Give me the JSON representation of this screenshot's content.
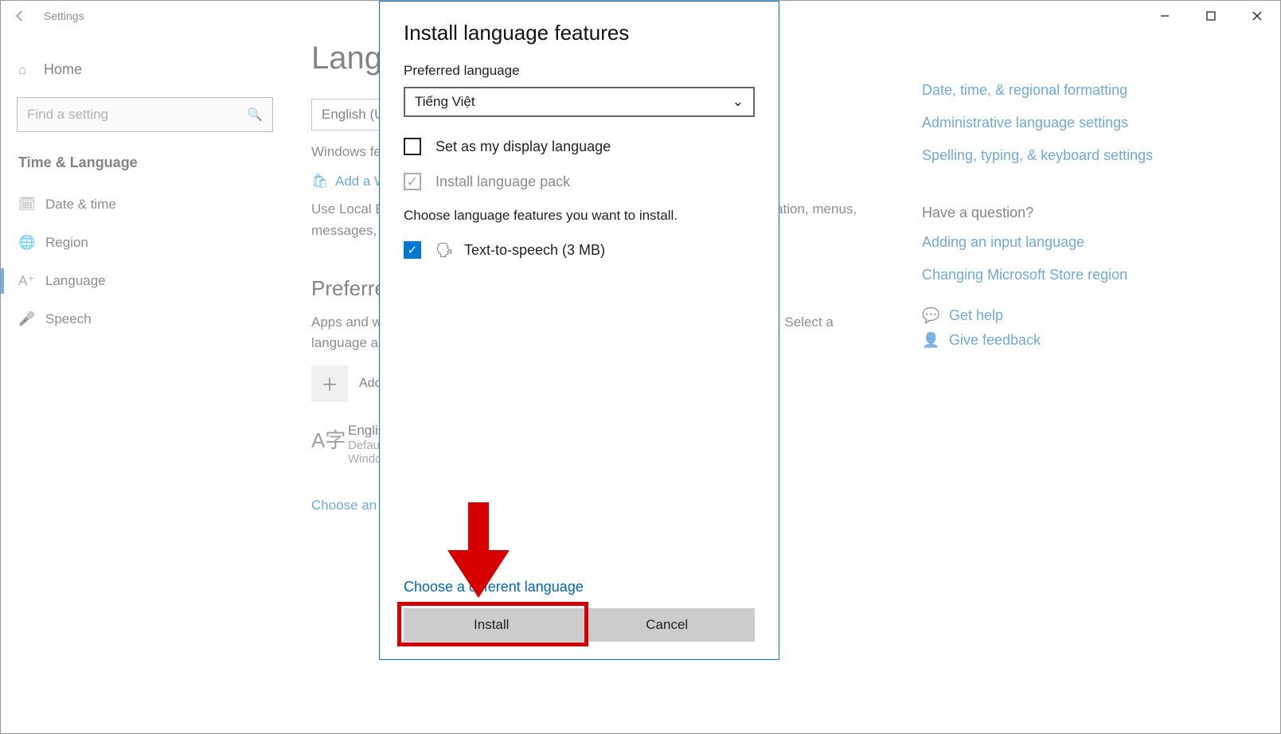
{
  "titlebar": {
    "title": "Settings"
  },
  "sidebar": {
    "home": "Home",
    "search_placeholder": "Find a setting",
    "section": "Time & Language",
    "items": [
      {
        "label": "Date & time"
      },
      {
        "label": "Region"
      },
      {
        "label": "Language"
      },
      {
        "label": "Speech"
      }
    ]
  },
  "main": {
    "heading": "Language",
    "display_lang_value": "English (United States)",
    "display_lang_desc": "Windows features like Settings and File Explorer will appear in this language.",
    "add_display_link": "Add a Windows display language in Microsoft Store",
    "local_exp_desc": "Use Local Experience Packs to change the language Windows uses for navigation, menus, messages, settings, and help topics.",
    "pref_heading": "Preferred languages",
    "pref_desc": "Apps and websites will appear in the first language in the list that they support. Select a language and then select Options to configure keyboards and other features.",
    "add_lang": "Add a language",
    "lang_name": "English (United States)",
    "lang_sub1": "Default app language; Default input language;",
    "lang_sub2": "Windows display language",
    "choose_input": "Choose an input method to always use as default"
  },
  "rightcol": {
    "link1": "Date, time, & regional formatting",
    "link2": "Administrative language settings",
    "link3": "Spelling, typing, & keyboard settings",
    "question": "Have a question?",
    "help1": "Adding an input language",
    "help2": "Changing Microsoft Store region",
    "gethelp": "Get help",
    "feedback": "Give feedback"
  },
  "modal": {
    "title": "Install language features",
    "pref_label": "Preferred language",
    "selected": "Tiếng Việt",
    "set_display": "Set as my display language",
    "install_pack": "Install language pack",
    "choose_feat": "Choose language features you want to install.",
    "tts": "Text-to-speech (3 MB)",
    "choose_diff": "Choose a different language",
    "install_btn": "Install",
    "cancel_btn": "Cancel"
  }
}
